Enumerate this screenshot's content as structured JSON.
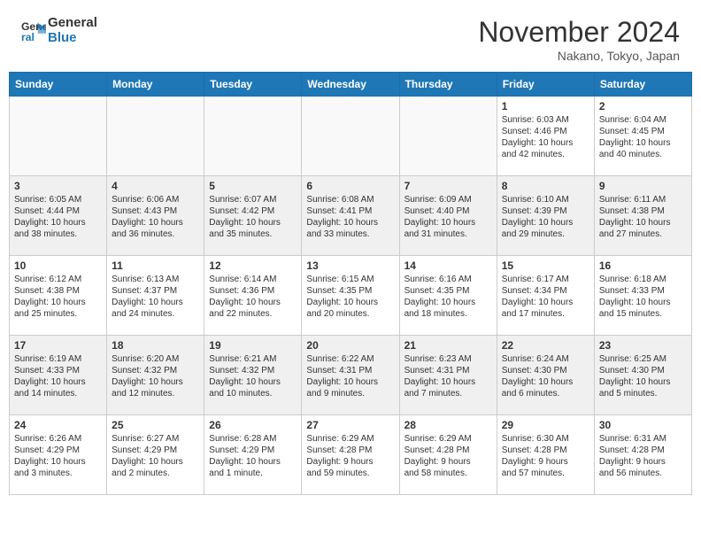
{
  "header": {
    "logo_line1": "General",
    "logo_line2": "Blue",
    "month": "November 2024",
    "location": "Nakano, Tokyo, Japan"
  },
  "weekdays": [
    "Sunday",
    "Monday",
    "Tuesday",
    "Wednesday",
    "Thursday",
    "Friday",
    "Saturday"
  ],
  "weeks": [
    [
      {
        "day": "",
        "info": ""
      },
      {
        "day": "",
        "info": ""
      },
      {
        "day": "",
        "info": ""
      },
      {
        "day": "",
        "info": ""
      },
      {
        "day": "",
        "info": ""
      },
      {
        "day": "1",
        "info": "Sunrise: 6:03 AM\nSunset: 4:46 PM\nDaylight: 10 hours\nand 42 minutes."
      },
      {
        "day": "2",
        "info": "Sunrise: 6:04 AM\nSunset: 4:45 PM\nDaylight: 10 hours\nand 40 minutes."
      }
    ],
    [
      {
        "day": "3",
        "info": "Sunrise: 6:05 AM\nSunset: 4:44 PM\nDaylight: 10 hours\nand 38 minutes."
      },
      {
        "day": "4",
        "info": "Sunrise: 6:06 AM\nSunset: 4:43 PM\nDaylight: 10 hours\nand 36 minutes."
      },
      {
        "day": "5",
        "info": "Sunrise: 6:07 AM\nSunset: 4:42 PM\nDaylight: 10 hours\nand 35 minutes."
      },
      {
        "day": "6",
        "info": "Sunrise: 6:08 AM\nSunset: 4:41 PM\nDaylight: 10 hours\nand 33 minutes."
      },
      {
        "day": "7",
        "info": "Sunrise: 6:09 AM\nSunset: 4:40 PM\nDaylight: 10 hours\nand 31 minutes."
      },
      {
        "day": "8",
        "info": "Sunrise: 6:10 AM\nSunset: 4:39 PM\nDaylight: 10 hours\nand 29 minutes."
      },
      {
        "day": "9",
        "info": "Sunrise: 6:11 AM\nSunset: 4:38 PM\nDaylight: 10 hours\nand 27 minutes."
      }
    ],
    [
      {
        "day": "10",
        "info": "Sunrise: 6:12 AM\nSunset: 4:38 PM\nDaylight: 10 hours\nand 25 minutes."
      },
      {
        "day": "11",
        "info": "Sunrise: 6:13 AM\nSunset: 4:37 PM\nDaylight: 10 hours\nand 24 minutes."
      },
      {
        "day": "12",
        "info": "Sunrise: 6:14 AM\nSunset: 4:36 PM\nDaylight: 10 hours\nand 22 minutes."
      },
      {
        "day": "13",
        "info": "Sunrise: 6:15 AM\nSunset: 4:35 PM\nDaylight: 10 hours\nand 20 minutes."
      },
      {
        "day": "14",
        "info": "Sunrise: 6:16 AM\nSunset: 4:35 PM\nDaylight: 10 hours\nand 18 minutes."
      },
      {
        "day": "15",
        "info": "Sunrise: 6:17 AM\nSunset: 4:34 PM\nDaylight: 10 hours\nand 17 minutes."
      },
      {
        "day": "16",
        "info": "Sunrise: 6:18 AM\nSunset: 4:33 PM\nDaylight: 10 hours\nand 15 minutes."
      }
    ],
    [
      {
        "day": "17",
        "info": "Sunrise: 6:19 AM\nSunset: 4:33 PM\nDaylight: 10 hours\nand 14 minutes."
      },
      {
        "day": "18",
        "info": "Sunrise: 6:20 AM\nSunset: 4:32 PM\nDaylight: 10 hours\nand 12 minutes."
      },
      {
        "day": "19",
        "info": "Sunrise: 6:21 AM\nSunset: 4:32 PM\nDaylight: 10 hours\nand 10 minutes."
      },
      {
        "day": "20",
        "info": "Sunrise: 6:22 AM\nSunset: 4:31 PM\nDaylight: 10 hours\nand 9 minutes."
      },
      {
        "day": "21",
        "info": "Sunrise: 6:23 AM\nSunset: 4:31 PM\nDaylight: 10 hours\nand 7 minutes."
      },
      {
        "day": "22",
        "info": "Sunrise: 6:24 AM\nSunset: 4:30 PM\nDaylight: 10 hours\nand 6 minutes."
      },
      {
        "day": "23",
        "info": "Sunrise: 6:25 AM\nSunset: 4:30 PM\nDaylight: 10 hours\nand 5 minutes."
      }
    ],
    [
      {
        "day": "24",
        "info": "Sunrise: 6:26 AM\nSunset: 4:29 PM\nDaylight: 10 hours\nand 3 minutes."
      },
      {
        "day": "25",
        "info": "Sunrise: 6:27 AM\nSunset: 4:29 PM\nDaylight: 10 hours\nand 2 minutes."
      },
      {
        "day": "26",
        "info": "Sunrise: 6:28 AM\nSunset: 4:29 PM\nDaylight: 10 hours\nand 1 minute."
      },
      {
        "day": "27",
        "info": "Sunrise: 6:29 AM\nSunset: 4:28 PM\nDaylight: 9 hours\nand 59 minutes."
      },
      {
        "day": "28",
        "info": "Sunrise: 6:29 AM\nSunset: 4:28 PM\nDaylight: 9 hours\nand 58 minutes."
      },
      {
        "day": "29",
        "info": "Sunrise: 6:30 AM\nSunset: 4:28 PM\nDaylight: 9 hours\nand 57 minutes."
      },
      {
        "day": "30",
        "info": "Sunrise: 6:31 AM\nSunset: 4:28 PM\nDaylight: 9 hours\nand 56 minutes."
      }
    ]
  ]
}
